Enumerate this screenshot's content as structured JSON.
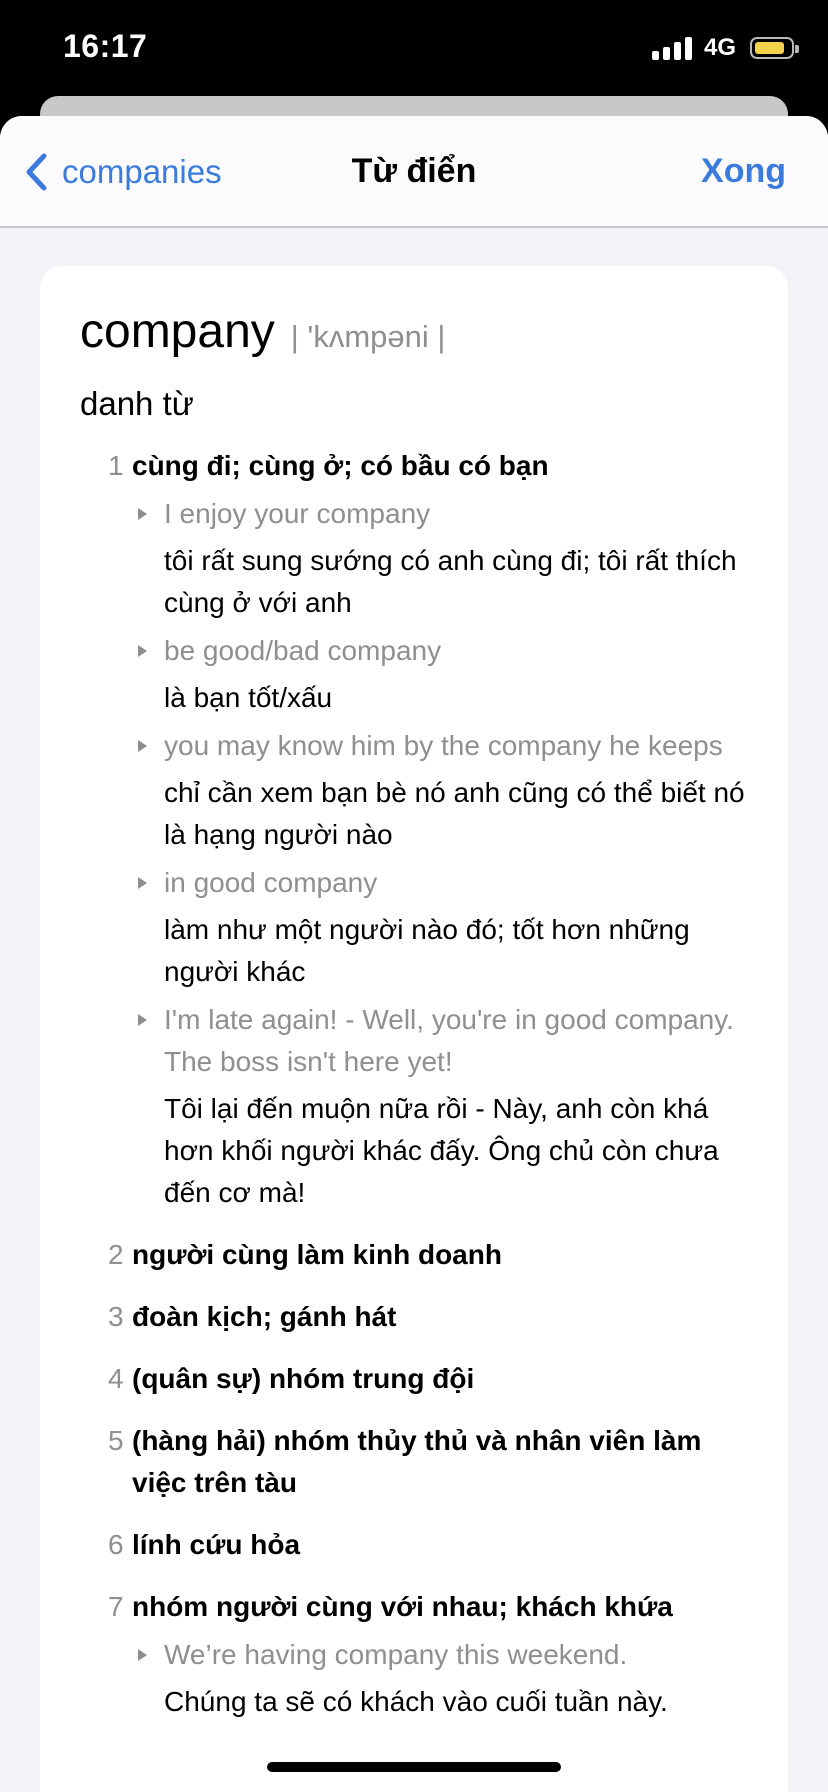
{
  "status_bar": {
    "time": "16:17",
    "network": "4G",
    "signal_icon": "cellular-signal-icon",
    "battery_icon": "battery-icon",
    "battery_color": "#f4d24b"
  },
  "nav": {
    "back_label": "companies",
    "title": "Từ điển",
    "done_label": "Xong",
    "accent_color": "#3a7bdc"
  },
  "entry": {
    "headword": "company",
    "pronunciation": "| 'kʌmpəni |",
    "part_of_speech": "danh từ",
    "senses": [
      {
        "num": "1",
        "text": "cùng đi; cùng ở; có bầu có bạn",
        "examples": [
          {
            "en": "I enjoy your company",
            "vi": "tôi rất sung sướng có anh cùng đi; tôi rất thích cùng ở với anh"
          },
          {
            "en": "be good/bad company",
            "vi": "là bạn tốt/xấu"
          },
          {
            "en": "you may know him by the company he keeps",
            "vi": "chỉ cần xem bạn bè nó anh cũng có thể biết nó là hạng người nào"
          },
          {
            "en": "in good company",
            "vi": "làm như một người nào đó; tốt hơn những người khác"
          },
          {
            "en": "I'm late again! - Well, you're in good company. The boss isn't here yet!",
            "vi": "Tôi lại đến muộn nữa rồi - Này, anh còn khá hơn khối người khác đấy. Ông chủ còn chưa đến cơ mà!"
          }
        ]
      },
      {
        "num": "2",
        "text": "người cùng làm kinh doanh",
        "examples": []
      },
      {
        "num": "3",
        "text": "đoàn kịch; gánh hát",
        "examples": []
      },
      {
        "num": "4",
        "text": "(quân sự) nhóm trung đội",
        "examples": []
      },
      {
        "num": "5",
        "text": "(hàng hải) nhóm thủy thủ và nhân viên làm việc trên tàu",
        "examples": []
      },
      {
        "num": "6",
        "text": "lính cứu hỏa",
        "examples": []
      },
      {
        "num": "7",
        "text": "nhóm người cùng với nhau; khách khứa",
        "examples": [
          {
            "en": "We’re having company this weekend.",
            "vi": "Chúng ta sẽ có khách vào cuối tuần này."
          }
        ]
      }
    ]
  }
}
